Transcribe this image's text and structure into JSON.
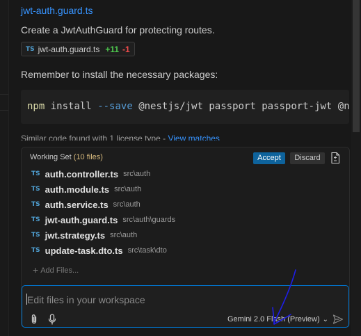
{
  "response": {
    "file_link": "jwt-auth.guard.ts",
    "description": "Create a JwtAuthGuard for protecting routes.",
    "edit_chip": {
      "lang": "TS",
      "file": "jwt-auth.guard.ts",
      "added": "+11",
      "removed": "-1"
    },
    "install_note": "Remember to install the necessary packages:",
    "code": {
      "cmd": "npm",
      "sub": "install",
      "flag": "--save",
      "args": "@nestjs/jwt passport passport-jwt @nestj"
    },
    "similar_code": {
      "text": "Similar code found with 1 license type - ",
      "link": "View matches"
    }
  },
  "working_set": {
    "title": "Working Set",
    "count": "(10 files)",
    "accept_label": "Accept",
    "discard_label": "Discard",
    "files": [
      {
        "lang": "TS",
        "name": "auth.controller.ts",
        "path": "src\\auth"
      },
      {
        "lang": "TS",
        "name": "auth.module.ts",
        "path": "src\\auth"
      },
      {
        "lang": "TS",
        "name": "auth.service.ts",
        "path": "src\\auth"
      },
      {
        "lang": "TS",
        "name": "jwt-auth.guard.ts",
        "path": "src\\auth\\guards"
      },
      {
        "lang": "TS",
        "name": "jwt.strategy.ts",
        "path": "src\\auth"
      },
      {
        "lang": "TS",
        "name": "update-task.dto.ts",
        "path": "src\\task\\dto"
      }
    ],
    "add_files_label": "Add Files..."
  },
  "input": {
    "placeholder": "Edit files in your workspace",
    "model": "Gemini 2.0 Flash (Preview)"
  },
  "icons": {
    "attach": "paperclip-icon",
    "mic": "microphone-icon",
    "send": "send-icon",
    "view_diff": "file-diff-icon",
    "model_dropdown": "chevron-down-icon"
  },
  "colors": {
    "accent": "#0078d4",
    "link": "#3794ff",
    "added": "#4ec94e",
    "removed": "#f14c4c",
    "annotation": "#1e1ee6"
  }
}
